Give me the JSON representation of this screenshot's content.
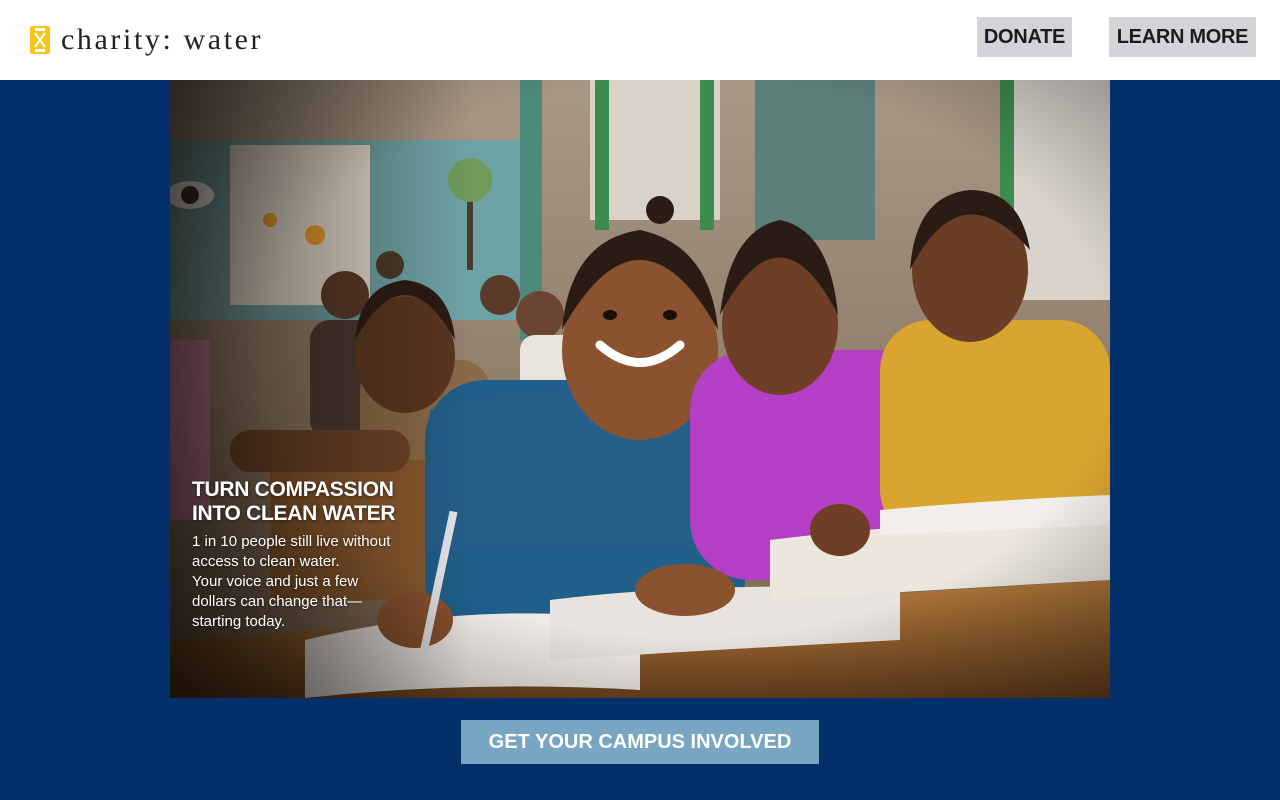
{
  "header": {
    "brand_name": "charity: water",
    "logo_icon": "jerrycan-icon",
    "brand_color": "#f5c51b",
    "donate_label": "DONATE",
    "learn_more_label": "LEARN MORE"
  },
  "hero": {
    "image_subject": "hero-photo",
    "title_line1": "TURN COMPASSION",
    "title_line2": "INTO CLEAN WATER",
    "body_lines": [
      "1 in 10 people still live without",
      "access to clean water.",
      "Your voice and just a few",
      "dollars can change that—",
      "starting today."
    ]
  },
  "cta": {
    "label": "GET YOUR CAMPUS INVOLVED",
    "color": "#77a5c2"
  },
  "colors": {
    "page_background": "#03306a",
    "button_background": "#d2d4d8"
  }
}
